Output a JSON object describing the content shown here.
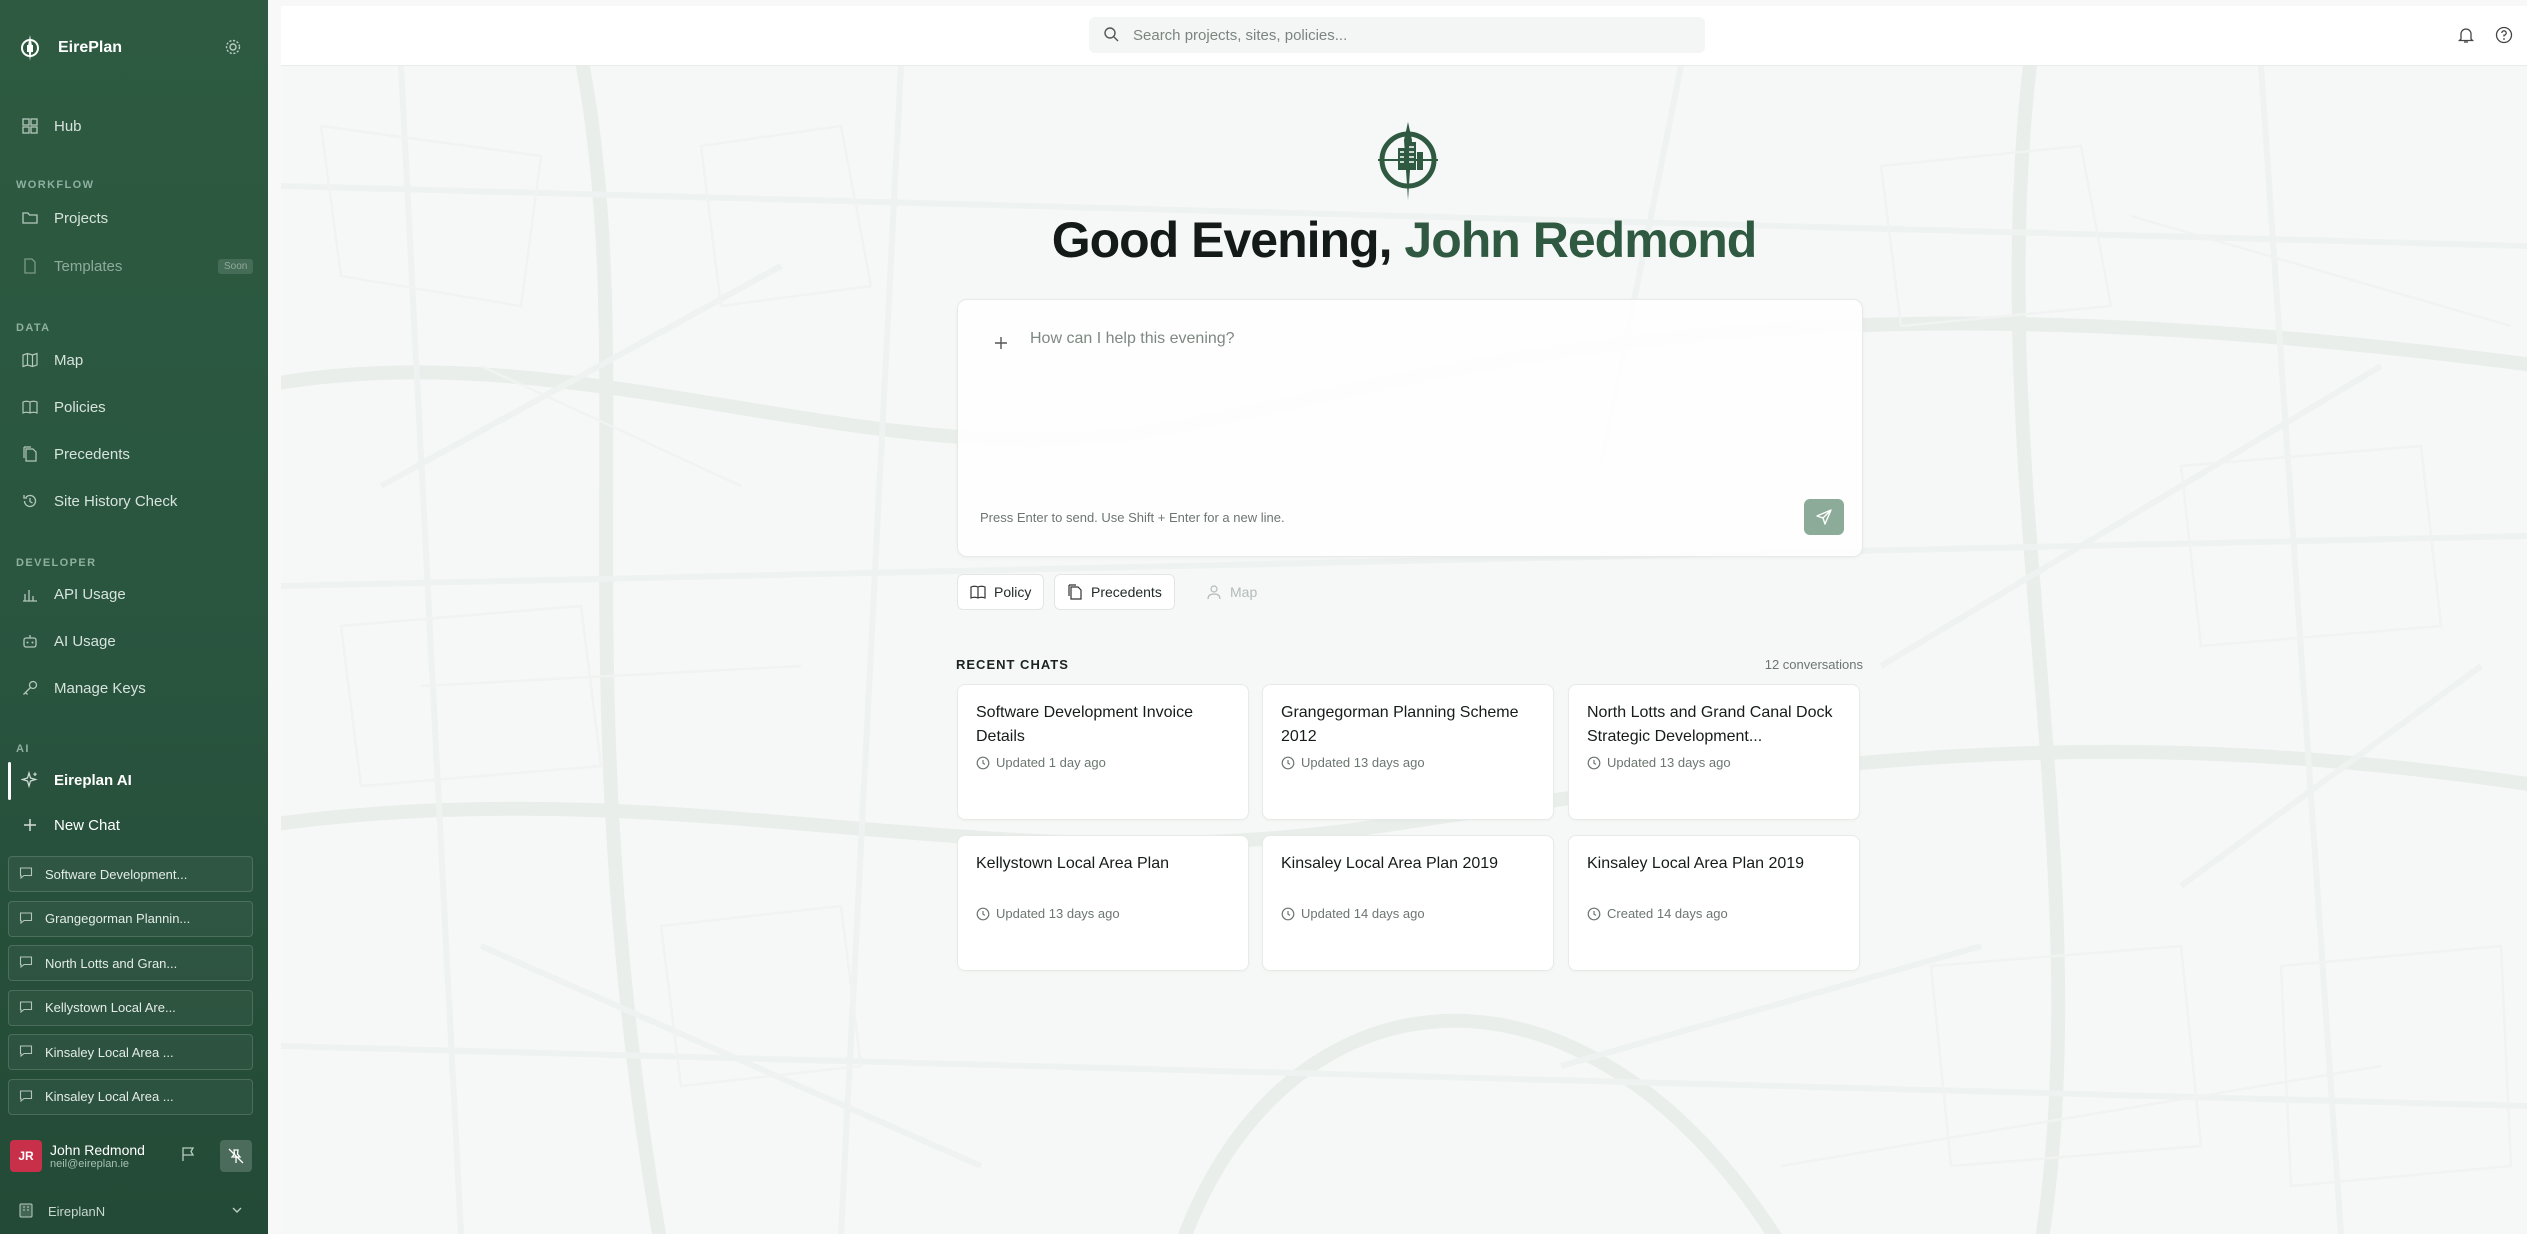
{
  "app": {
    "name": "EirePlan",
    "colors": {
      "sidebar": "#2d5a40",
      "accent": "#2f5a41",
      "avatar": "#c8304a",
      "send": "#8cab99"
    }
  },
  "sidebar": {
    "hub_label": "Hub",
    "workflow_label": "WORKFLOW",
    "projects_label": "Projects",
    "templates_label": "Templates",
    "templates_badge": "Soon",
    "data_label": "DATA",
    "map_label": "Map",
    "policies_label": "Policies",
    "precedents_label": "Precedents",
    "site_history_label": "Site History Check",
    "developer_label": "DEVELOPER",
    "api_usage_label": "API Usage",
    "ai_usage_label": "AI Usage",
    "manage_keys_label": "Manage Keys",
    "ai_label": "AI",
    "eireplan_ai_label": "Eireplan AI",
    "new_chat_label": "New Chat",
    "chats": [
      "Software Development...",
      "Grangegorman Plannin...",
      "North Lotts and Gran...",
      "Kellystown Local Are...",
      "Kinsaley Local Area ...",
      "Kinsaley Local Area ..."
    ],
    "user": {
      "initials": "JR",
      "name": "John Redmond",
      "email": "neil@eireplan.ie"
    },
    "org_name": "EireplanN"
  },
  "header": {
    "search_placeholder": "Search projects, sites, policies..."
  },
  "main": {
    "greeting_prefix": "Good Evening,",
    "greeting_name": "John Redmond",
    "composer_placeholder": "How can I help this evening?",
    "composer_hint": "Press Enter to send. Use Shift + Enter for a new line.",
    "tools": {
      "policy": "Policy",
      "precedents": "Precedents",
      "map": "Map"
    },
    "recent_label": "RECENT CHATS",
    "recent_count": "12 conversations",
    "cards": [
      {
        "title": "Software Development Invoice Details",
        "meta": "Updated 1 day ago"
      },
      {
        "title": "Grangegorman Planning Scheme 2012",
        "meta": "Updated 13 days ago"
      },
      {
        "title": "North Lotts and Grand Canal Dock Strategic Development...",
        "meta": "Updated 13 days ago"
      },
      {
        "title": "Kellystown Local Area Plan",
        "meta": "Updated 13 days ago"
      },
      {
        "title": "Kinsaley Local Area Plan 2019",
        "meta": "Updated 14 days ago"
      },
      {
        "title": "Kinsaley Local Area Plan 2019",
        "meta": "Created 14 days ago"
      }
    ]
  }
}
